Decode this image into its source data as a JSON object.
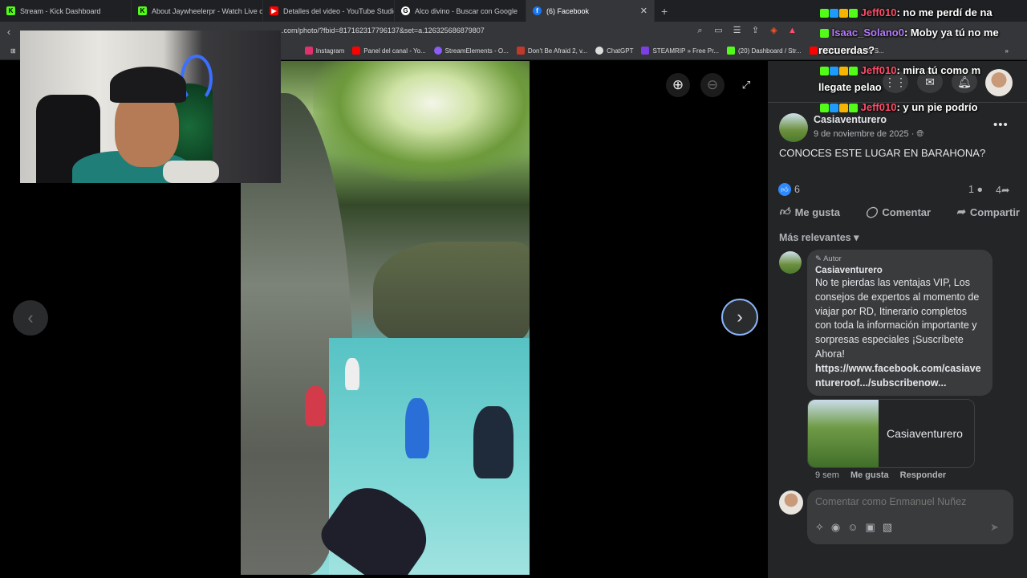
{
  "tabs": [
    {
      "label": "Stream - Kick Dashboard",
      "icon": "kick-icon",
      "color": "#53fc18"
    },
    {
      "label": "About Jaywheelerpr - Watch Live on",
      "icon": "kick-icon",
      "color": "#53fc18"
    },
    {
      "label": "Detalles del video - YouTube Studio",
      "icon": "youtube-icon",
      "color": "#ff0000"
    },
    {
      "label": "Alco divino - Buscar con Google",
      "icon": "google-icon",
      "color": "#ffffff"
    },
    {
      "label": "(6) Facebook",
      "icon": "facebook-icon",
      "color": "#1877f2"
    }
  ],
  "address": {
    "url": "...com/photo/?fbid=817162317796137&set=a.126325686879807"
  },
  "bookmarks": [
    {
      "label": "Instagram",
      "color": "#e1306c"
    },
    {
      "label": "Panel del canal - Yo...",
      "color": "#ff0000"
    },
    {
      "label": "StreamElements - O...",
      "color": "#8b5cf6"
    },
    {
      "label": "Don't Be Afraid 2, v...",
      "color": "#c0392b"
    },
    {
      "label": "ChatGPT",
      "color": "#dddddd"
    },
    {
      "label": "STEAMRIP » Free Pr...",
      "color": "#7b3fe4"
    },
    {
      "label": "(20) Dashboard / Str...",
      "color": "#53fc18"
    },
    {
      "label": "(1567) How to IRL S...",
      "color": "#ff0000"
    }
  ],
  "chat": [
    {
      "user": "Jeff010",
      "user_color": "#ff4d6a",
      "text": ": no me perdí de na"
    },
    {
      "user": "Isaac_Solano0",
      "user_color": "#b77bff",
      "text": ": Moby ya tú no me"
    },
    {
      "user": "",
      "user_color": "#ffffff",
      "text": "recuerdas?"
    },
    {
      "user": "Jeff010",
      "user_color": "#ff4d6a",
      "text": ": mira tú como m"
    },
    {
      "user": "",
      "user_color": "#ffffff",
      "text": "llegate pelao"
    },
    {
      "user": "Jeff010",
      "user_color": "#ff4d6a",
      "text": ": y un pie podrío"
    }
  ],
  "post": {
    "author": "Casiaventurero",
    "date": "9 de noviembre de 2025 · ",
    "caption": "CONOCES ESTE LUGAR EN BARAHONA?",
    "likes": "6",
    "comments": "1",
    "shares": "4",
    "like_label": "Me gusta",
    "comment_label": "Comentar",
    "share_label": "Compartir",
    "relevance_label": "Más relevantes"
  },
  "comment": {
    "badge": "Autor",
    "author": "Casiaventurero",
    "text": "No te pierdas las ventajas VIP, Los consejos de expertos al momento de viajar por RD, Itinerario completos con toda la información importante y sorpresas especiales ¡Suscríbete Ahora!",
    "link": "https://www.facebook.com/casiaventureroof.../subscribenow...",
    "card_title": "Casiaventurero",
    "time": "9 sem",
    "like_label": "Me gusta",
    "reply_label": "Responder"
  },
  "composer": {
    "placeholder": "Comentar como Enmanuel Nuñez"
  }
}
